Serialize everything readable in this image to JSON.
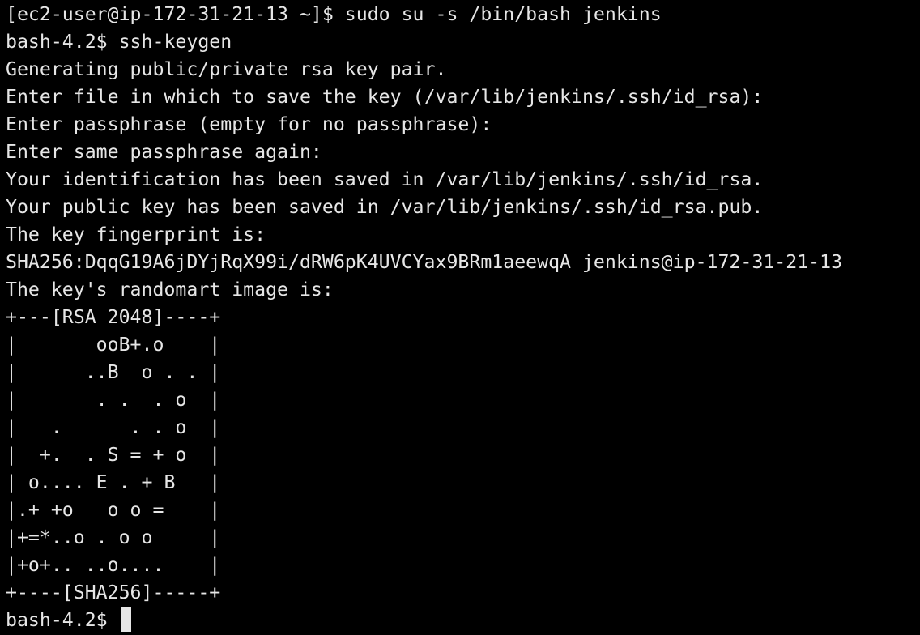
{
  "theme": {
    "background": "#000000",
    "foreground": "#e6e6e6",
    "cursor": "#e6e6e6"
  },
  "lines": [
    "[ec2-user@ip-172-31-21-13 ~]$ sudo su -s /bin/bash jenkins",
    "bash-4.2$ ssh-keygen",
    "Generating public/private rsa key pair.",
    "Enter file in which to save the key (/var/lib/jenkins/.ssh/id_rsa):",
    "Enter passphrase (empty for no passphrase):",
    "Enter same passphrase again:",
    "Your identification has been saved in /var/lib/jenkins/.ssh/id_rsa.",
    "Your public key has been saved in /var/lib/jenkins/.ssh/id_rsa.pub.",
    "The key fingerprint is:",
    "SHA256:DqqG19A6jDYjRqX99i/dRW6pK4UVCYax9BRm1aeewqA jenkins@ip-172-31-21-13",
    "The key's randomart image is:",
    "+---[RSA 2048]----+",
    "|       ooB+.o    |",
    "|      ..B  o . . |",
    "|       . .  . o  |",
    "|   .      . . o  |",
    "|  +.  . S = + o  |",
    "| o.... E . + B   |",
    "|.+ +o   o o =    |",
    "|+=*..o . o o     |",
    "|+o+.. ..o....    |",
    "+----[SHA256]-----+"
  ],
  "prompt": "bash-4.2$ "
}
